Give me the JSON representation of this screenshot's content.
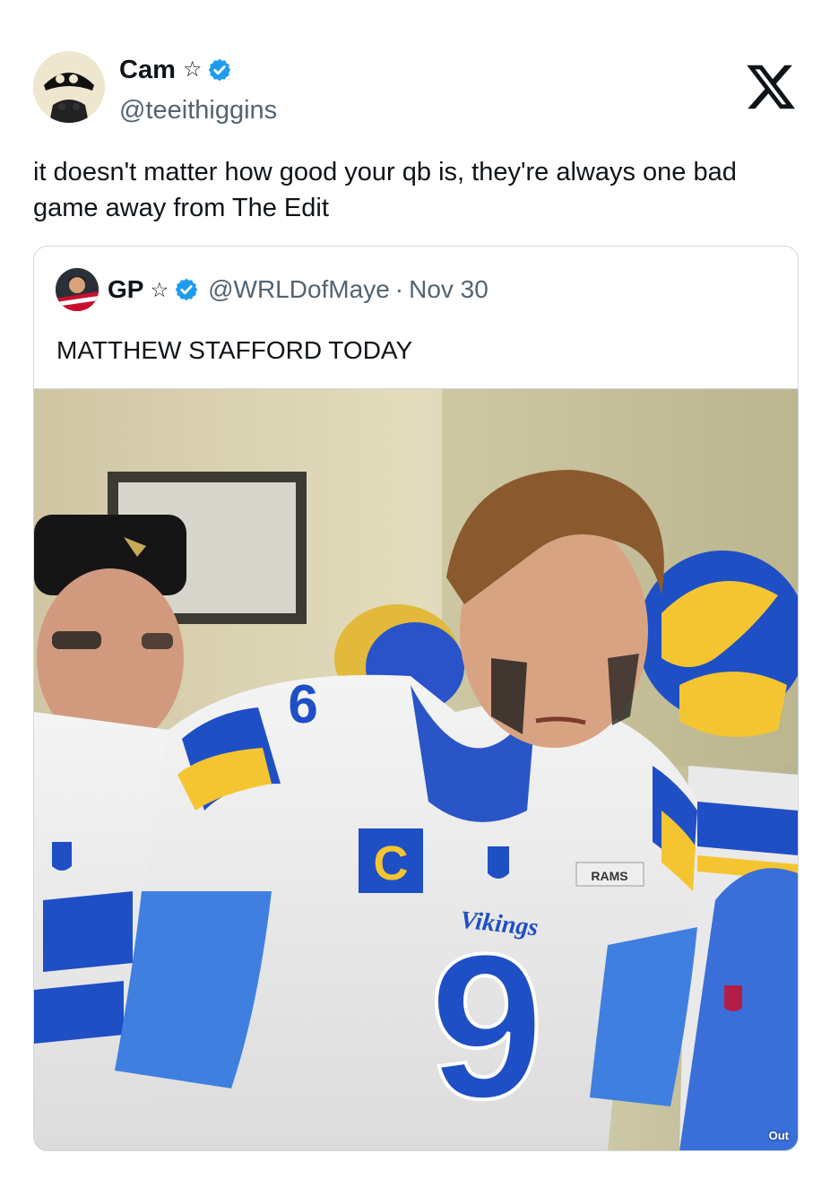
{
  "tweet": {
    "author": {
      "name": "Cam",
      "name_badge": "☆",
      "handle": "@teeithiggins"
    },
    "text": "it doesn't matter how good your qb is, they're always one bad game away from The Edit"
  },
  "quoted_tweet": {
    "author": {
      "name": "GP",
      "name_badge": "☆",
      "handle": "@WRLDofMaye",
      "separator": "·",
      "date": "Nov 30"
    },
    "text": "MATTHEW STAFFORD TODAY",
    "media": {
      "jersey_wordmark": "Vikings",
      "jersey_number": "9",
      "patch_text": "RAMS",
      "captain_letter": "C",
      "watermark": "Out"
    }
  },
  "icons": {
    "verified": "verified-badge-icon",
    "platform_logo": "x-logo-icon",
    "star": "star-outline-icon"
  },
  "colors": {
    "text_primary": "#0f1419",
    "text_secondary": "#536471",
    "verified_blue": "#1d9bf0",
    "border": "#cfd9de",
    "rams_blue": "#1f4fc4",
    "rams_yellow": "#f4c531"
  }
}
